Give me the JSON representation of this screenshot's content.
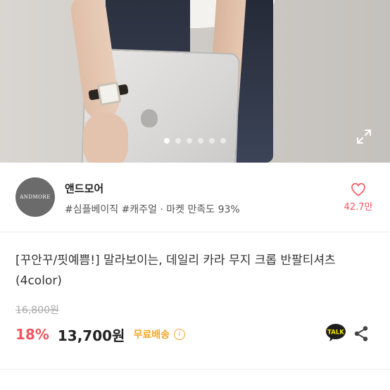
{
  "gallery": {
    "image_alt": "product photo",
    "total_images": 6,
    "active_index": 0
  },
  "shop": {
    "logo_text": "ANDMORE",
    "name": "앤드모어",
    "tags": "#심플베이직 #캐주얼 · 마켓 만족도 93%",
    "like_count": "42.7만"
  },
  "product": {
    "title": "[꾸안꾸/핏예쁨!] 말라보이는, 데일리 카라 무지 크롭 반팔티셔츠 (4color)",
    "original_price": "16,800원",
    "discount": "18%",
    "sale_price": "13,700원",
    "shipping": "무료배송",
    "talk_label": "TALK"
  },
  "colors": {
    "accent_red": "#f0555f",
    "shipping_orange": "#f5a623"
  },
  "icons": {
    "expand": "expand-icon",
    "heart": "heart-icon",
    "info": "info-icon",
    "talk": "kakaotalk-icon",
    "share": "share-icon"
  }
}
